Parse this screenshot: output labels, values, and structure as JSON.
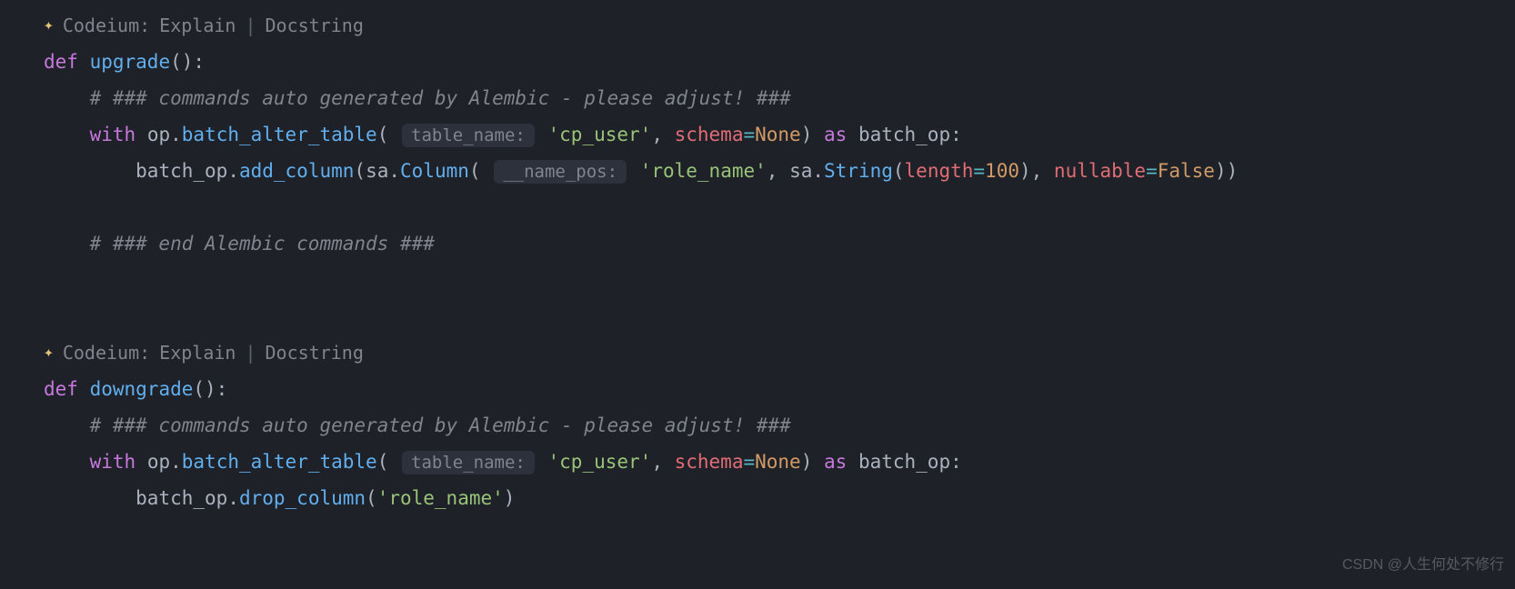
{
  "codeium": {
    "brand": "Codeium:",
    "explain": "Explain",
    "docstring": "Docstring",
    "sep": "|"
  },
  "code": {
    "def": "def",
    "with": "with",
    "as": "as",
    "upgrade_fn": "upgrade",
    "downgrade_fn": "downgrade",
    "comment_auto": "# ### commands auto generated by Alembic - please adjust! ###",
    "comment_end": "# ### end Alembic commands ###",
    "op": "op",
    "batch_alter_table": "batch_alter_table",
    "hint_table_name": "table_name:",
    "hint_name_pos": "__name_pos:",
    "cp_user": "'cp_user'",
    "schema": "schema",
    "none": "None",
    "batch_op": "batch_op",
    "add_column": "add_column",
    "drop_column": "drop_column",
    "sa": "sa",
    "Column": "Column",
    "role_name": "'role_name'",
    "String": "String",
    "length": "length",
    "hundred": "100",
    "nullable": "nullable",
    "false": "False"
  },
  "watermark": "CSDN @人生何处不修行"
}
